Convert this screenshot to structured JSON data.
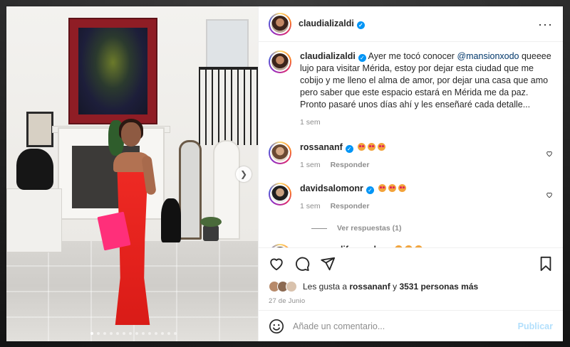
{
  "post": {
    "author": "claudializaldi",
    "verified": true,
    "caption_parts": [
      "Ayer me tocó conocer ",
      "@mansionxodo",
      " queeee lujo para visitar Mérida, estoy por dejar esta ciudad que me cobijo y me lleno el alma de amor, por dejar una casa que amo pero saber que este espacio estará en Mérida me da paz. Pronto pasaré unos días ahí y les enseñaré cada detalle..."
    ],
    "caption_time": "1 sem",
    "image_dots": 14
  },
  "header": {
    "username": "claudializaldi",
    "more_icon": "more-horizontal-icon"
  },
  "comments": [
    {
      "username": "rossananf",
      "verified": true,
      "emojis": 3,
      "time": "1 sem",
      "reply": "Responder"
    },
    {
      "username": "davidsalomonr",
      "verified": true,
      "emojis": 3,
      "time": "1 sem",
      "reply": "Responder",
      "view_replies": "Ver respuestas (1)"
    },
    {
      "username": "apapazoslifecoach",
      "verified": true,
      "emojis": 3
    }
  ],
  "actions": {
    "like_icon": "heart-icon",
    "comment_icon": "comment-icon",
    "share_icon": "send-icon",
    "save_icon": "bookmark-icon"
  },
  "likes": {
    "prefix": "Les gusta a ",
    "user": "rossananf",
    "middle": " y ",
    "count": "3531 personas más"
  },
  "date": "27 de Junio",
  "composer": {
    "emoji_icon": "smiley-icon",
    "placeholder": "Añade un comentario...",
    "publish_label": "Publicar"
  },
  "colors": {
    "accent_blue": "#0095f6",
    "publish_disabled": "#b2dffc",
    "dress_red": "#e3211c",
    "clutch_pink": "#ff2f7a"
  }
}
